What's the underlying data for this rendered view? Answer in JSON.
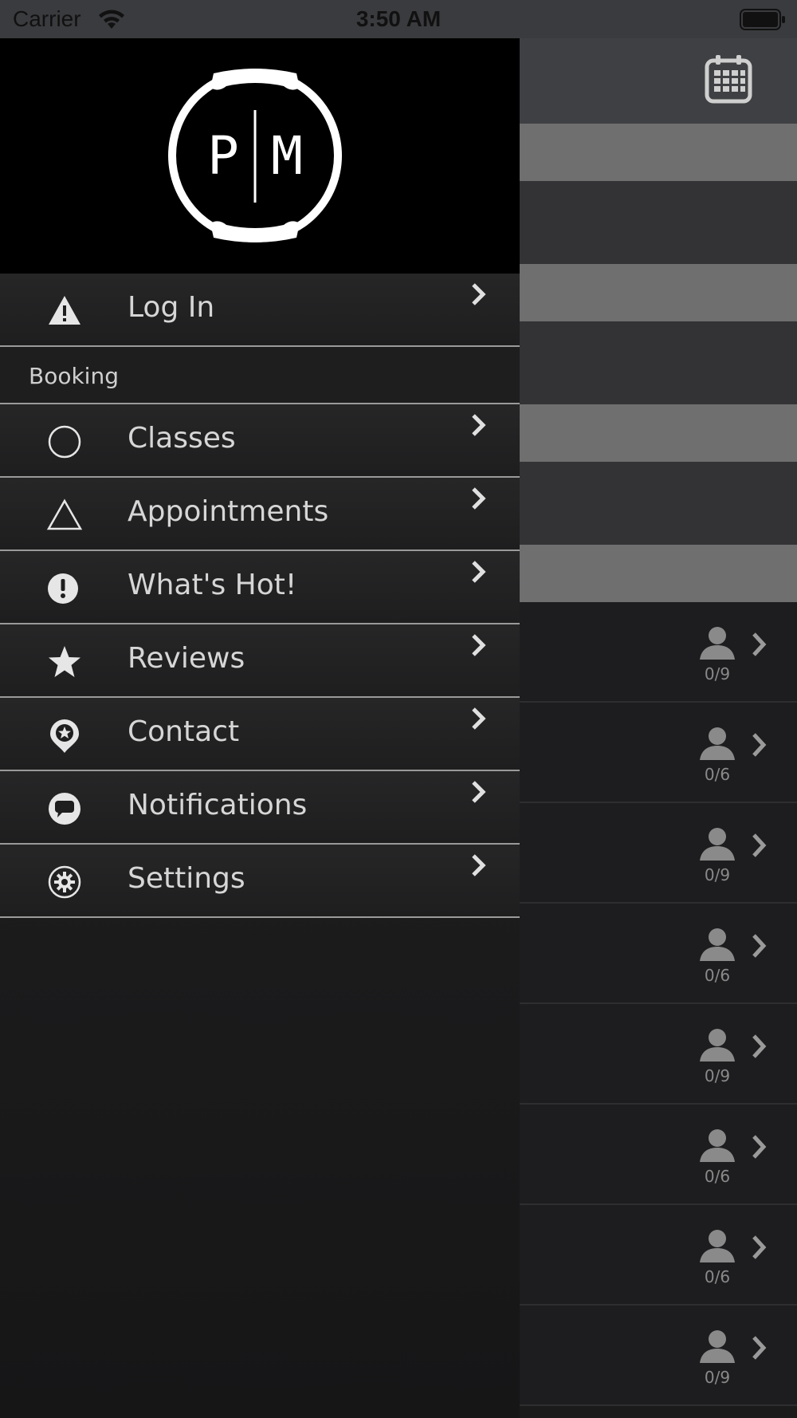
{
  "status_bar": {
    "carrier": "Carrier",
    "time": "3:50 AM"
  },
  "drawer": {
    "logo_text_left": "P",
    "logo_text_right": "M",
    "items": [
      {
        "label": "Log In",
        "icon": "warning-icon"
      },
      {
        "section": "Booking"
      },
      {
        "label": "Classes",
        "icon": "circle-icon"
      },
      {
        "label": "Appointments",
        "icon": "triangle-icon"
      },
      {
        "label": "What's Hot!",
        "icon": "exclamation-icon"
      },
      {
        "label": "Reviews",
        "icon": "star-icon"
      },
      {
        "label": "Contact",
        "icon": "location-pin-icon"
      },
      {
        "label": "Notifications",
        "icon": "chat-bubble-icon"
      },
      {
        "label": "Settings",
        "icon": "gear-icon"
      }
    ]
  },
  "class_list": {
    "capacities": [
      "0/9",
      "0/6",
      "0/9",
      "0/6",
      "0/9",
      "0/6",
      "0/6",
      "0/9"
    ]
  },
  "colors": {
    "drawer_bg": "#1c1c1d",
    "header_bg": "#000000",
    "divider": "#9a9a9a",
    "text": "#d6d6d6",
    "band_gray": "#6f6f6f"
  }
}
